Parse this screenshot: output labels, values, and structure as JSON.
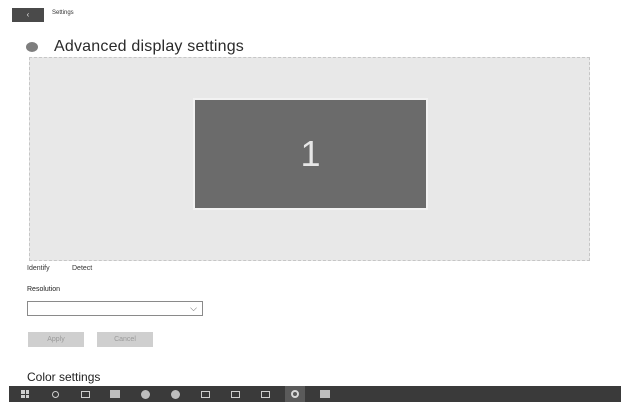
{
  "window": {
    "title": "Settings",
    "back_glyph": "‹"
  },
  "header": {
    "icon": "gear-icon",
    "title": "Advanced display settings"
  },
  "display_area": {
    "monitor_number": "1"
  },
  "links": {
    "identify": "Identify",
    "detect": "Detect"
  },
  "resolution": {
    "label": "Resolution",
    "selected_value": "",
    "chevron": "⌵"
  },
  "buttons": {
    "apply": "Apply",
    "cancel": "Cancel"
  },
  "sections": {
    "color_settings": "Color settings"
  },
  "taskbar": {
    "items": [
      "windows-start-icon",
      "search-icon",
      "task-view-icon",
      "mail-icon",
      "edge-icon",
      "chrome-icon",
      "file-explorer-icon",
      "photos-icon",
      "image-icon",
      "settings-icon",
      "store-icon"
    ]
  },
  "colors": {
    "taskbar": "#3a3a3a",
    "monitor": "#6b6b6b",
    "monitor_area": "#e8e8e8",
    "button_disabled": "#cfcfcf"
  }
}
